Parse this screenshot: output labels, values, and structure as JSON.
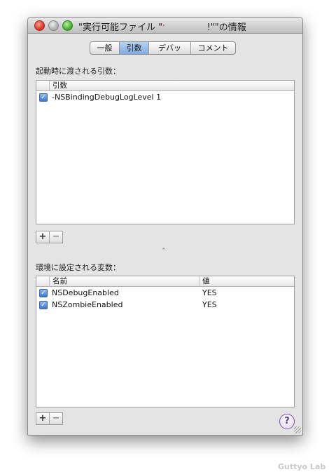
{
  "window": {
    "title_prefix": "\"実行可能ファイル \"",
    "title_redacted": "’",
    "title_suffix": "!\"\"の情報"
  },
  "tabs": [
    {
      "label": "一般",
      "active": false
    },
    {
      "label": "引数",
      "active": true
    },
    {
      "label": "デバッグ",
      "active": false
    },
    {
      "label": "コメント",
      "active": false
    }
  ],
  "arguments_section": {
    "label": "起動時に渡される引数：",
    "column_header": "引数",
    "rows": [
      {
        "checked": true,
        "value": "-NSBindingDebugLogLevel 1"
      }
    ]
  },
  "env_section": {
    "label": "環境に設定される変数：",
    "column_name": "名前",
    "column_value": "値",
    "rows": [
      {
        "checked": true,
        "name": "NSDebugEnabled",
        "value": "YES"
      },
      {
        "checked": true,
        "name": "NSZombieEnabled",
        "value": "YES"
      }
    ]
  },
  "buttons": {
    "add": "+",
    "remove": "−",
    "help": "?"
  },
  "watermark": "Guttyo Lab"
}
